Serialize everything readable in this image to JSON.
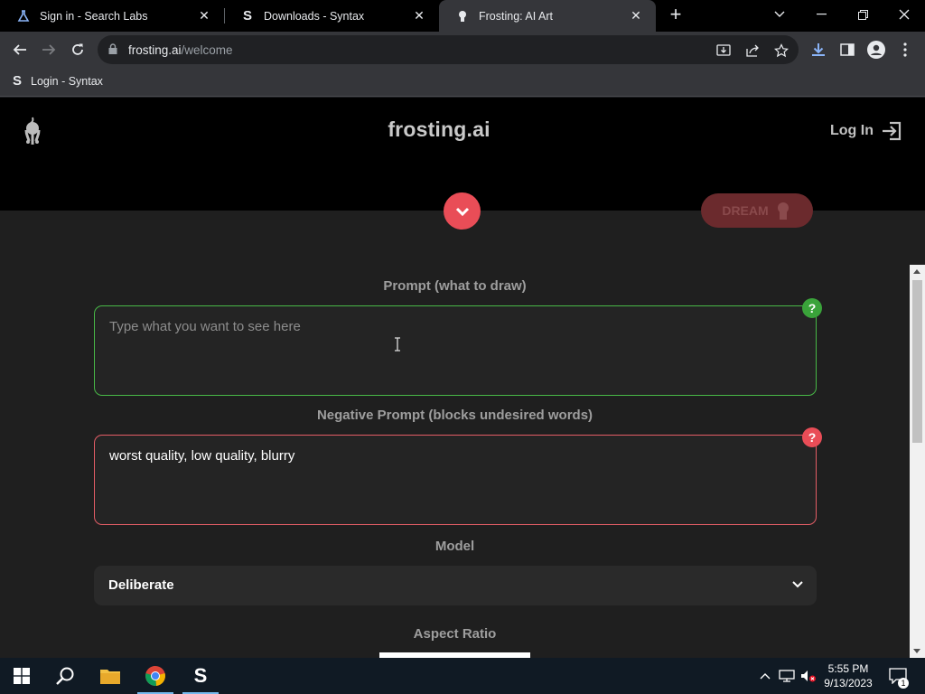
{
  "browser": {
    "tabs": [
      {
        "title": "Sign in - Search Labs",
        "icon": "flask-icon"
      },
      {
        "title": "Downloads - Syntax",
        "icon": "syntax-s-icon"
      },
      {
        "title": "Frosting: AI Art",
        "icon": "frosting-icon",
        "active": true
      }
    ],
    "url_host": "frosting.ai",
    "url_path": "/welcome",
    "bookmarks": [
      {
        "label": "Login - Syntax",
        "icon": "syntax-s-icon"
      }
    ]
  },
  "site": {
    "title": "frosting.ai",
    "login_label": "Log In",
    "dream_label": "DREAM",
    "prompt_label": "Prompt (what to draw)",
    "prompt_placeholder": "Type what you want to see here",
    "prompt_help": "?",
    "negative_label": "Negative Prompt (blocks undesired words)",
    "negative_value": "worst quality, low quality, blurry",
    "negative_help": "?",
    "model_label": "Model",
    "model_value": "Deliberate",
    "aspect_label": "Aspect Ratio"
  },
  "taskbar": {
    "time": "5:55 PM",
    "date": "9/13/2023",
    "notifications": "1"
  },
  "colors": {
    "accent_red": "#e94d57",
    "accent_green": "#48b847",
    "page_bg": "#1f1f1f"
  }
}
